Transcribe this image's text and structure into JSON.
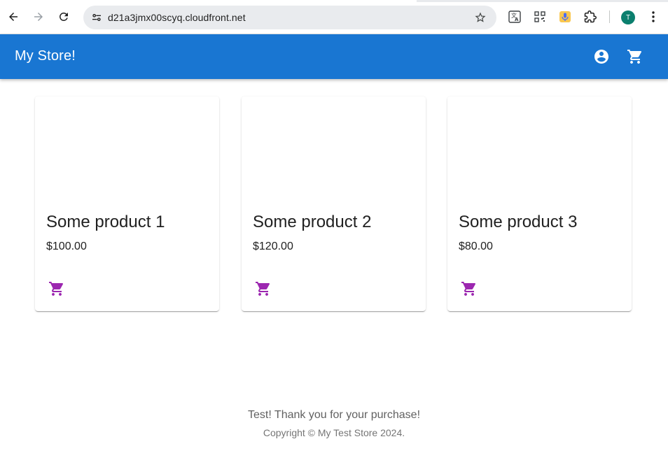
{
  "browser": {
    "url": "d21a3jmx00scyq.cloudfront.net",
    "profile_initial": "T",
    "icons": [
      "back-arrow-icon",
      "forward-arrow-icon",
      "reload-icon",
      "site-info-icon",
      "bookmark-star-icon",
      "translate-extension-icon",
      "qr-extension-icon",
      "mic-extension-icon",
      "extensions-puzzle-icon",
      "more-menu-icon"
    ]
  },
  "appbar": {
    "title": "My Store!",
    "icons": [
      "account-circle-icon",
      "shopping-cart-icon"
    ],
    "color": "#1976d2"
  },
  "products": [
    {
      "name": "Some product 1",
      "price": "$100.00"
    },
    {
      "name": "Some product 2",
      "price": "$120.00"
    },
    {
      "name": "Some product 3",
      "price": "$80.00"
    }
  ],
  "product_cart_icon_color": "#9c27b0",
  "footer": {
    "message": "Test! Thank you for your purchase!",
    "copyright": "Copyright © My Test Store 2024."
  }
}
